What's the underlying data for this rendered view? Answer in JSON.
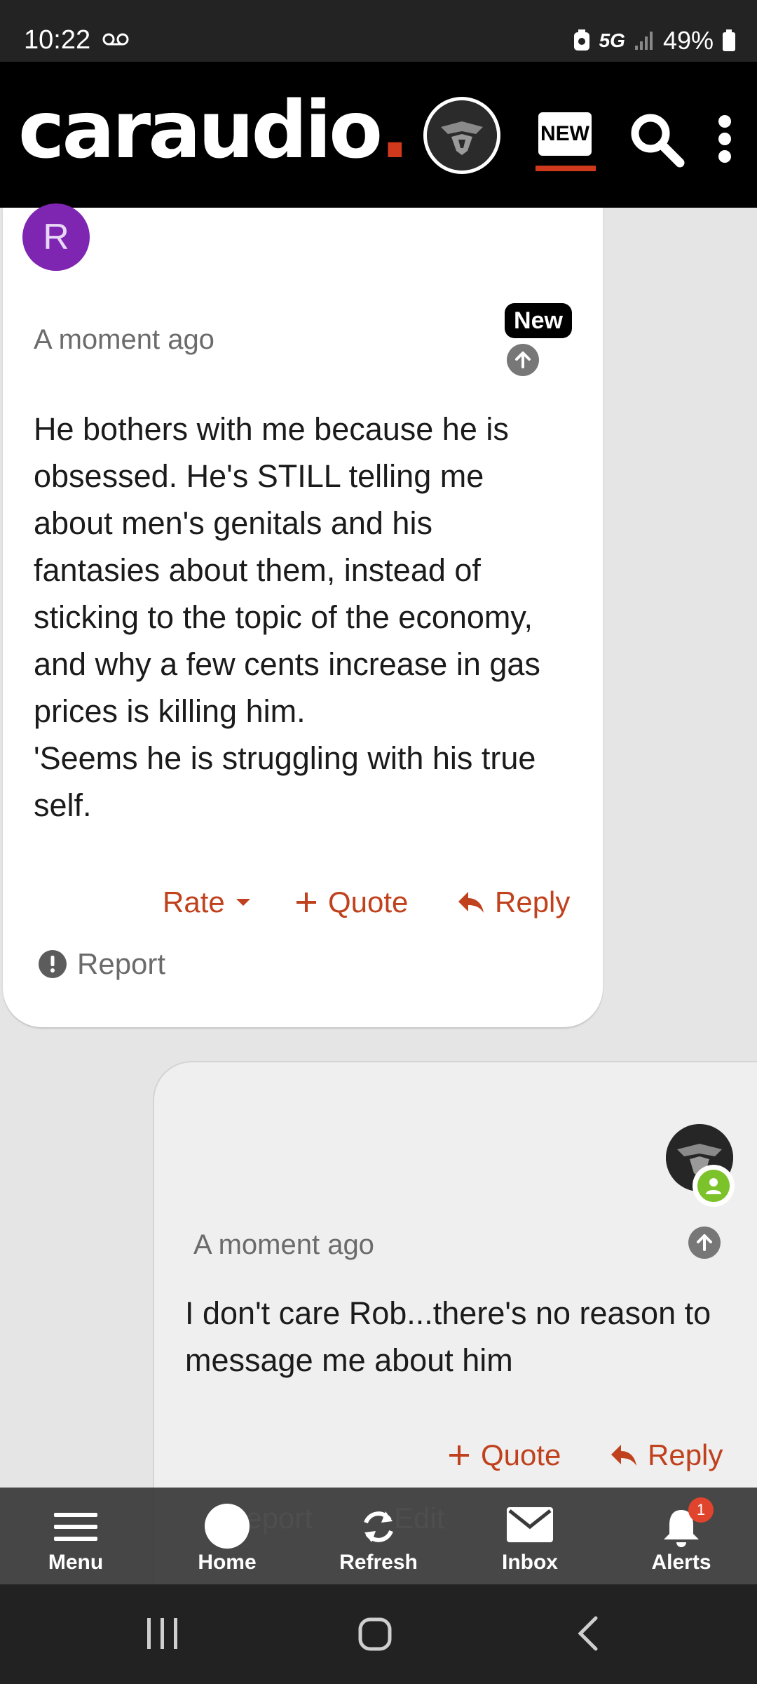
{
  "status_bar": {
    "time": "10:22",
    "network": "5G",
    "battery": "49%"
  },
  "header": {
    "logo_text": "caraudio",
    "logo_dot": ".",
    "new_label": "NEW",
    "accent_color": "#d0391c"
  },
  "posts": [
    {
      "avatar_letter": "R",
      "avatar_color": "#7e25b2",
      "time": "A moment ago",
      "badge": "New",
      "lines": [
        "He bothers with me because he is",
        "obsessed. He's STILL telling me",
        "about men's genitals and his",
        "fantasies about them, instead of",
        "sticking to the topic of the economy,",
        "and why a few cents increase in gas",
        "prices is killing him.",
        "'Seems he is struggling with his true",
        "self."
      ],
      "actions": {
        "rate": "Rate",
        "quote": "Quote",
        "reply": "Reply",
        "report": "Report"
      }
    },
    {
      "time": "A moment ago",
      "lines": [
        "I don't care Rob...there's no reason to",
        "message me about him"
      ],
      "actions": {
        "quote": "Quote",
        "reply": "Reply",
        "report": "Report",
        "edit": "Edit"
      }
    }
  ],
  "bottom_nav": {
    "items": [
      "Menu",
      "Home",
      "Refresh",
      "Inbox",
      "Alerts"
    ],
    "alerts_count": "1"
  }
}
